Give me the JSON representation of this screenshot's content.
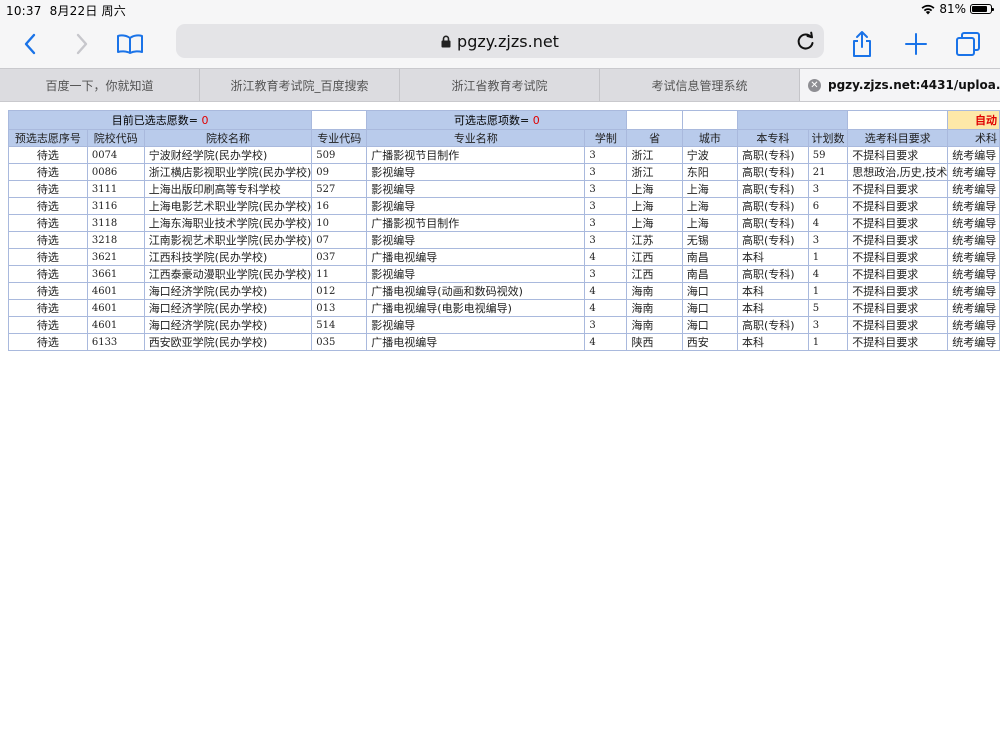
{
  "status_bar": {
    "time": "10:37",
    "date": "8月22日 周六",
    "battery": "81%",
    "battery_level": 0.81
  },
  "address_bar": {
    "url": "pgzy.zjzs.net"
  },
  "tabs": [
    {
      "label": "百度一下，你就知道"
    },
    {
      "label": "浙江教育考试院_百度搜索"
    },
    {
      "label": "浙江省教育考试院"
    },
    {
      "label": "考试信息管理系统"
    },
    {
      "label": "pgzy.zjzs.net:4431/uploa..."
    }
  ],
  "summary": {
    "selected_label": "目前已选志愿数=",
    "selected_value": "0",
    "available_label": "可选志愿项数=",
    "available_value": "0",
    "auto_label": "自动"
  },
  "columns": [
    "预选志愿序号",
    "院校代码",
    "院校名称",
    "专业代码",
    "专业名称",
    "学制",
    "省",
    "城市",
    "本专科",
    "计划数",
    "选考科目要求",
    "术科"
  ],
  "rows": [
    [
      "待选",
      "0074",
      "宁波财经学院(民办学校)",
      "509",
      "广播影视节目制作",
      "3",
      "浙江",
      "宁波",
      "高职(专科)",
      "59",
      "不提科目要求",
      "统考编导"
    ],
    [
      "待选",
      "0086",
      "浙江横店影视职业学院(民办学校)",
      "09",
      "影视编导",
      "3",
      "浙江",
      "东阳",
      "高职(专科)",
      "21",
      "思想政治,历史,技术",
      "统考编导"
    ],
    [
      "待选",
      "3111",
      "上海出版印刷高等专科学校",
      "527",
      "影视编导",
      "3",
      "上海",
      "上海",
      "高职(专科)",
      "3",
      "不提科目要求",
      "统考编导"
    ],
    [
      "待选",
      "3116",
      "上海电影艺术职业学院(民办学校)",
      "16",
      "影视编导",
      "3",
      "上海",
      "上海",
      "高职(专科)",
      "6",
      "不提科目要求",
      "统考编导"
    ],
    [
      "待选",
      "3118",
      "上海东海职业技术学院(民办学校)",
      "10",
      "广播影视节目制作",
      "3",
      "上海",
      "上海",
      "高职(专科)",
      "4",
      "不提科目要求",
      "统考编导"
    ],
    [
      "待选",
      "3218",
      "江南影视艺术职业学院(民办学校)",
      "07",
      "影视编导",
      "3",
      "江苏",
      "无锡",
      "高职(专科)",
      "3",
      "不提科目要求",
      "统考编导"
    ],
    [
      "待选",
      "3621",
      "江西科技学院(民办学校)",
      "037",
      "广播电视编导",
      "4",
      "江西",
      "南昌",
      "本科",
      "1",
      "不提科目要求",
      "统考编导"
    ],
    [
      "待选",
      "3661",
      "江西泰豪动漫职业学院(民办学校)",
      "11",
      "影视编导",
      "3",
      "江西",
      "南昌",
      "高职(专科)",
      "4",
      "不提科目要求",
      "统考编导"
    ],
    [
      "待选",
      "4601",
      "海口经济学院(民办学校)",
      "012",
      "广播电视编导(动画和数码视效)",
      "4",
      "海南",
      "海口",
      "本科",
      "1",
      "不提科目要求",
      "统考编导"
    ],
    [
      "待选",
      "4601",
      "海口经济学院(民办学校)",
      "013",
      "广播电视编导(电影电视编导)",
      "4",
      "海南",
      "海口",
      "本科",
      "5",
      "不提科目要求",
      "统考编导"
    ],
    [
      "待选",
      "4601",
      "海口经济学院(民办学校)",
      "514",
      "影视编导",
      "3",
      "海南",
      "海口",
      "高职(专科)",
      "3",
      "不提科目要求",
      "统考编导"
    ],
    [
      "待选",
      "6133",
      "西安欧亚学院(民办学校)",
      "035",
      "广播电视编导",
      "4",
      "陕西",
      "西安",
      "本科",
      "1",
      "不提科目要求",
      "统考编导"
    ]
  ]
}
